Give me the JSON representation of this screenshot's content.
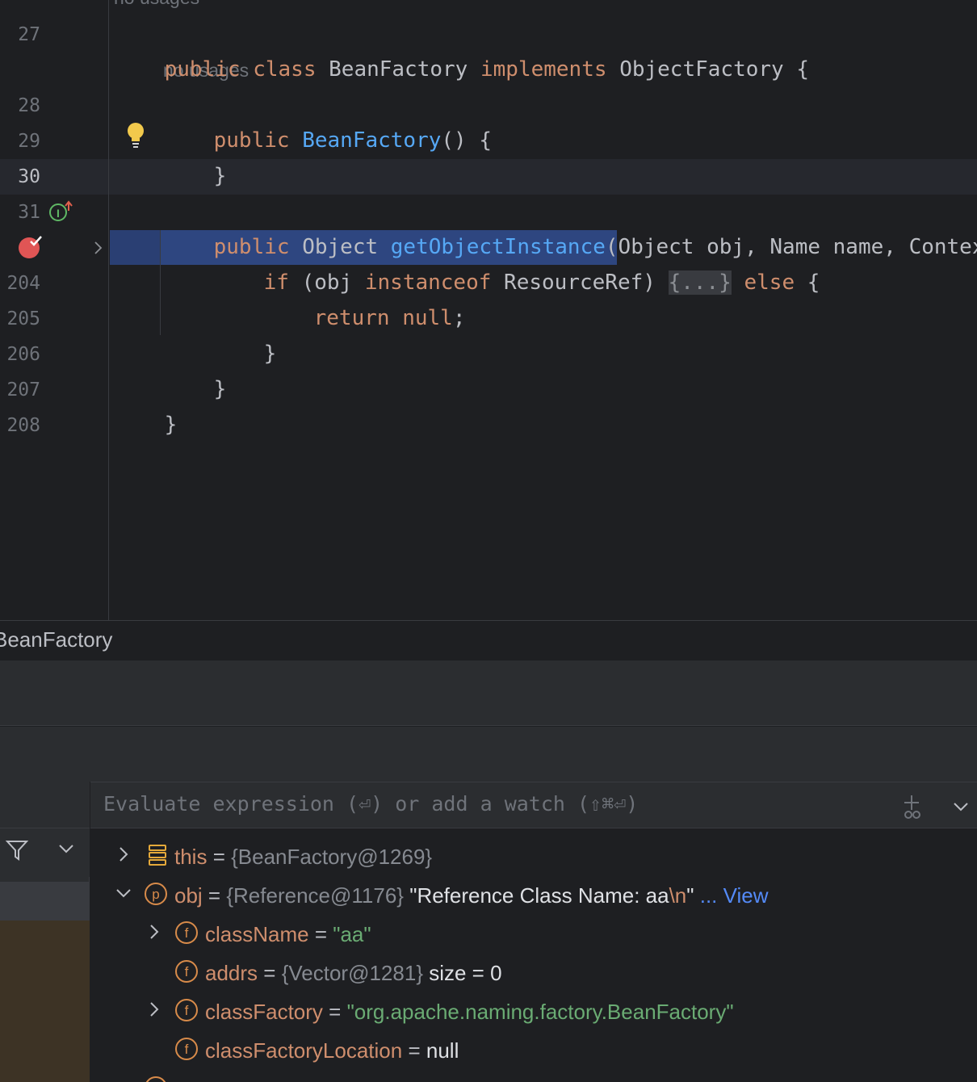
{
  "editor": {
    "hints": {
      "top": "no usages",
      "ctor": "no usages"
    },
    "line_numbers": [
      "27",
      "28",
      "29",
      "30",
      "31",
      "204",
      "205",
      "206",
      "207",
      "208"
    ],
    "lines": {
      "l27": {
        "kw1": "public",
        "kw2": "class",
        "name": "BeanFactory",
        "kw3": "implements",
        "iface": "ObjectFactory",
        "brace": " {"
      },
      "l28": {
        "kw": "public",
        "fn": "BeanFactory",
        "rest": "() {"
      },
      "l29": {
        "rest": "}"
      },
      "l31": {
        "kw": "public",
        "type": "Object",
        "fn": "getObjectInstance",
        "rest": "(Object obj, Name name, Context na"
      },
      "lbp": {
        "kw1": "if",
        "mid": " (obj ",
        "kw2": "instanceof",
        "type": " ResourceRef)",
        "fold": "{...}",
        "kw3": "else",
        "brace": " {"
      },
      "l204": {
        "kw": "return",
        "kw2": "null",
        "semi": ";"
      },
      "l205": {
        "rest": "}"
      },
      "l206": {
        "rest": "}"
      },
      "l207": {
        "rest": "}"
      }
    }
  },
  "breadcrumb": {
    "label": "BeanFactory"
  },
  "debugger": {
    "eval_placeholder": "Evaluate expression (⏎) or add a watch (⇧⌘⏎)",
    "variables": [
      {
        "name": "this",
        "eq": " = ",
        "type": "{BeanFactory@1269}"
      },
      {
        "name": "obj",
        "eq": " = ",
        "type": "{Reference@1176}",
        "value_a": " \"Reference Class Name: aa",
        "value_esc": "\\n",
        "value_b": "\"",
        "link": " ... View"
      },
      {
        "name": "className",
        "eq": " = ",
        "str": "\"aa\""
      },
      {
        "name": "addrs",
        "eq": " = ",
        "type": "{Vector@1281}",
        "extra": "  size = 0"
      },
      {
        "name": "classFactory",
        "eq": " = ",
        "str": "\"org.apache.naming.factory.BeanFactory\""
      },
      {
        "name": "classFactoryLocation",
        "eq": " = ",
        "val": "null"
      }
    ]
  },
  "colors": {
    "background": "#1e1f22",
    "keyword": "#cf8e6d",
    "function": "#56a8f5",
    "string": "#6aab73",
    "selection": "#2e4680",
    "link": "#548af7"
  }
}
